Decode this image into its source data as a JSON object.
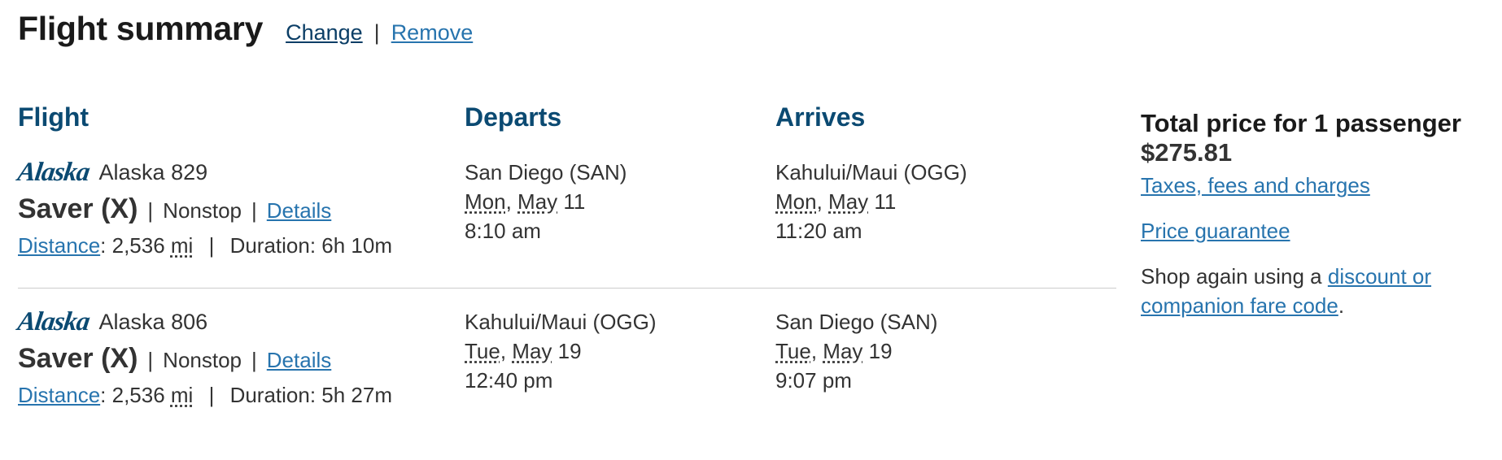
{
  "header": {
    "title": "Flight summary",
    "change_label": "Change",
    "separator": "|",
    "remove_label": "Remove"
  },
  "columns": {
    "flight": "Flight",
    "departs": "Departs",
    "arrives": "Arrives"
  },
  "flights": [
    {
      "airline_logo_text": "Alaska",
      "flight_name": "Alaska 829",
      "fare_class": "Saver (X)",
      "stops": "Nonstop",
      "details_label": "Details",
      "distance_label": "Distance",
      "distance_value": ": 2,536 ",
      "distance_unit": "mi",
      "duration": "Duration: 6h 10m",
      "depart": {
        "city": "San Diego (SAN)",
        "weekday": "Mon",
        "month": "May",
        "day": " 11",
        "time": "8:10 am"
      },
      "arrive": {
        "city": "Kahului/Maui (OGG)",
        "weekday": "Mon",
        "month": "May",
        "day": " 11",
        "time": "11:20 am"
      }
    },
    {
      "airline_logo_text": "Alaska",
      "flight_name": "Alaska 806",
      "fare_class": "Saver (X)",
      "stops": "Nonstop",
      "details_label": "Details",
      "distance_label": "Distance",
      "distance_value": ": 2,536 ",
      "distance_unit": "mi",
      "duration": "Duration: 5h 27m",
      "depart": {
        "city": "Kahului/Maui (OGG)",
        "weekday": "Tue",
        "month": "May",
        "day": " 19",
        "time": "12:40 pm"
      },
      "arrive": {
        "city": "San Diego (SAN)",
        "weekday": "Tue",
        "month": "May",
        "day": " 19",
        "time": "9:07 pm"
      }
    }
  ],
  "price": {
    "title": "Total price for 1 passenger",
    "amount": "$275.81",
    "taxes_link": "Taxes, fees and charges",
    "guarantee_link": "Price guarantee",
    "shop_again_prefix": "Shop again using a ",
    "shop_again_link": "discount or companion fare code",
    "shop_again_suffix": "."
  },
  "colors": {
    "link": "#2774ae",
    "heading": "#0b4a72",
    "text": "#333333"
  }
}
